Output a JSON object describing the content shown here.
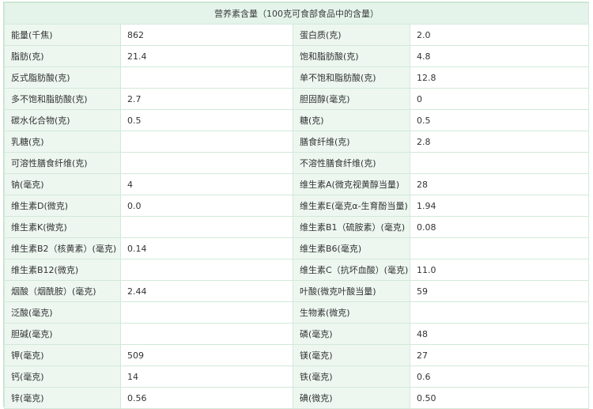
{
  "table": {
    "caption": "营养素含量（100克可食部食品中的含量）",
    "rows": [
      [
        "能量(千焦)",
        "862",
        "蛋白质(克)",
        "2.0"
      ],
      [
        "脂肪(克)",
        "21.4",
        "饱和脂肪酸(克)",
        "4.8"
      ],
      [
        "反式脂肪酸(克)",
        "",
        "单不饱和脂肪酸(克)",
        "12.8"
      ],
      [
        "多不饱和脂肪酸(克)",
        "2.7",
        "胆固醇(毫克)",
        "0"
      ],
      [
        "碳水化合物(克)",
        "0.5",
        "糖(克)",
        "0.5"
      ],
      [
        "乳糖(克)",
        "",
        "膳食纤维(克)",
        "2.8"
      ],
      [
        "可溶性膳食纤维(克)",
        "",
        "不溶性膳食纤维(克)",
        ""
      ],
      [
        "钠(毫克)",
        "4",
        "维生素A(微克视黄醇当量)",
        "28"
      ],
      [
        "维生素D(微克)",
        "0.0",
        "维生素E(毫克α-生育酚当量)",
        "1.94"
      ],
      [
        "维生素K(微克)",
        "",
        "维生素B1（硫胺素）(毫克)",
        "0.08"
      ],
      [
        "维生素B2（核黄素）(毫克)",
        "0.14",
        "维生素B6(毫克)",
        ""
      ],
      [
        "维生素B12(微克)",
        "",
        "维生素C（抗坏血酸）(毫克)",
        "11.0"
      ],
      [
        "烟酸（烟酰胺）(毫克)",
        "2.44",
        "叶酸(微克叶酸当量)",
        "59"
      ],
      [
        "泛酸(毫克)",
        "",
        "生物素(微克)",
        ""
      ],
      [
        "胆碱(毫克)",
        "",
        "磷(毫克)",
        "48"
      ],
      [
        "钾(毫克)",
        "509",
        "镁(毫克)",
        "27"
      ],
      [
        "钙(毫克)",
        "14",
        "铁(毫克)",
        "0.6"
      ],
      [
        "锌(毫克)",
        "0.56",
        "碘(微克)",
        "0.50"
      ]
    ]
  },
  "colors": {
    "header_bg": "#e4f4ea",
    "label_bg": "#edf7f0",
    "border": "#d2e9d9"
  }
}
